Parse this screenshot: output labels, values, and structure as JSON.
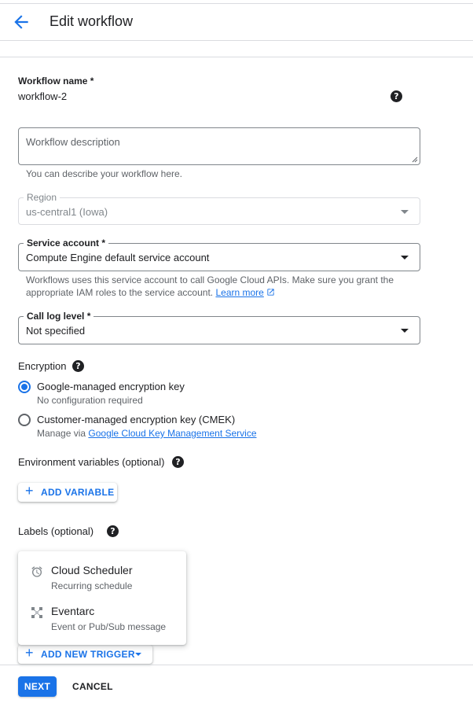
{
  "header": {
    "title": "Edit workflow",
    "back_icon": "arrow-back-icon"
  },
  "workflow_name": {
    "label": "Workflow name *",
    "value": "workflow-2",
    "help_icon": "help-icon"
  },
  "description": {
    "placeholder": "Workflow description",
    "hint": "You can describe your workflow here."
  },
  "region": {
    "label": "Region",
    "value": "us-central1 (Iowa)"
  },
  "service_account": {
    "label": "Service account *",
    "value": "Compute Engine default service account",
    "hint_line1": "Workflows uses this service account to call Google Cloud APIs. Make sure you grant the",
    "hint_line2": "appropriate IAM roles to the service account.",
    "learn_more": "Learn more"
  },
  "call_log": {
    "label": "Call log level *",
    "value": "Not specified"
  },
  "encryption": {
    "title": "Encryption",
    "options": [
      {
        "label": "Google-managed encryption key",
        "sub": "No configuration required",
        "selected": true
      },
      {
        "label": "Customer-managed encryption key (CMEK)",
        "sub_prefix": "Manage via",
        "sub_link": "Google Cloud Key Management Service",
        "selected": false
      }
    ]
  },
  "env_vars": {
    "title": "Environment variables (optional)",
    "add_button": "ADD VARIABLE"
  },
  "labels": {
    "title": "Labels (optional)"
  },
  "trigger_menu": {
    "items": [
      {
        "title": "Cloud Scheduler",
        "sub": "Recurring schedule",
        "icon": "alarm-icon"
      },
      {
        "title": "Eventarc",
        "sub": "Event or Pub/Sub message",
        "icon": "eventarc-icon"
      }
    ]
  },
  "add_trigger": {
    "label": "ADD NEW TRIGGER"
  },
  "footer": {
    "next": "NEXT",
    "cancel": "CANCEL"
  },
  "colors": {
    "accent": "#1a73e8",
    "text": "#202124",
    "secondary": "#5f6368",
    "border": "#80868b"
  }
}
